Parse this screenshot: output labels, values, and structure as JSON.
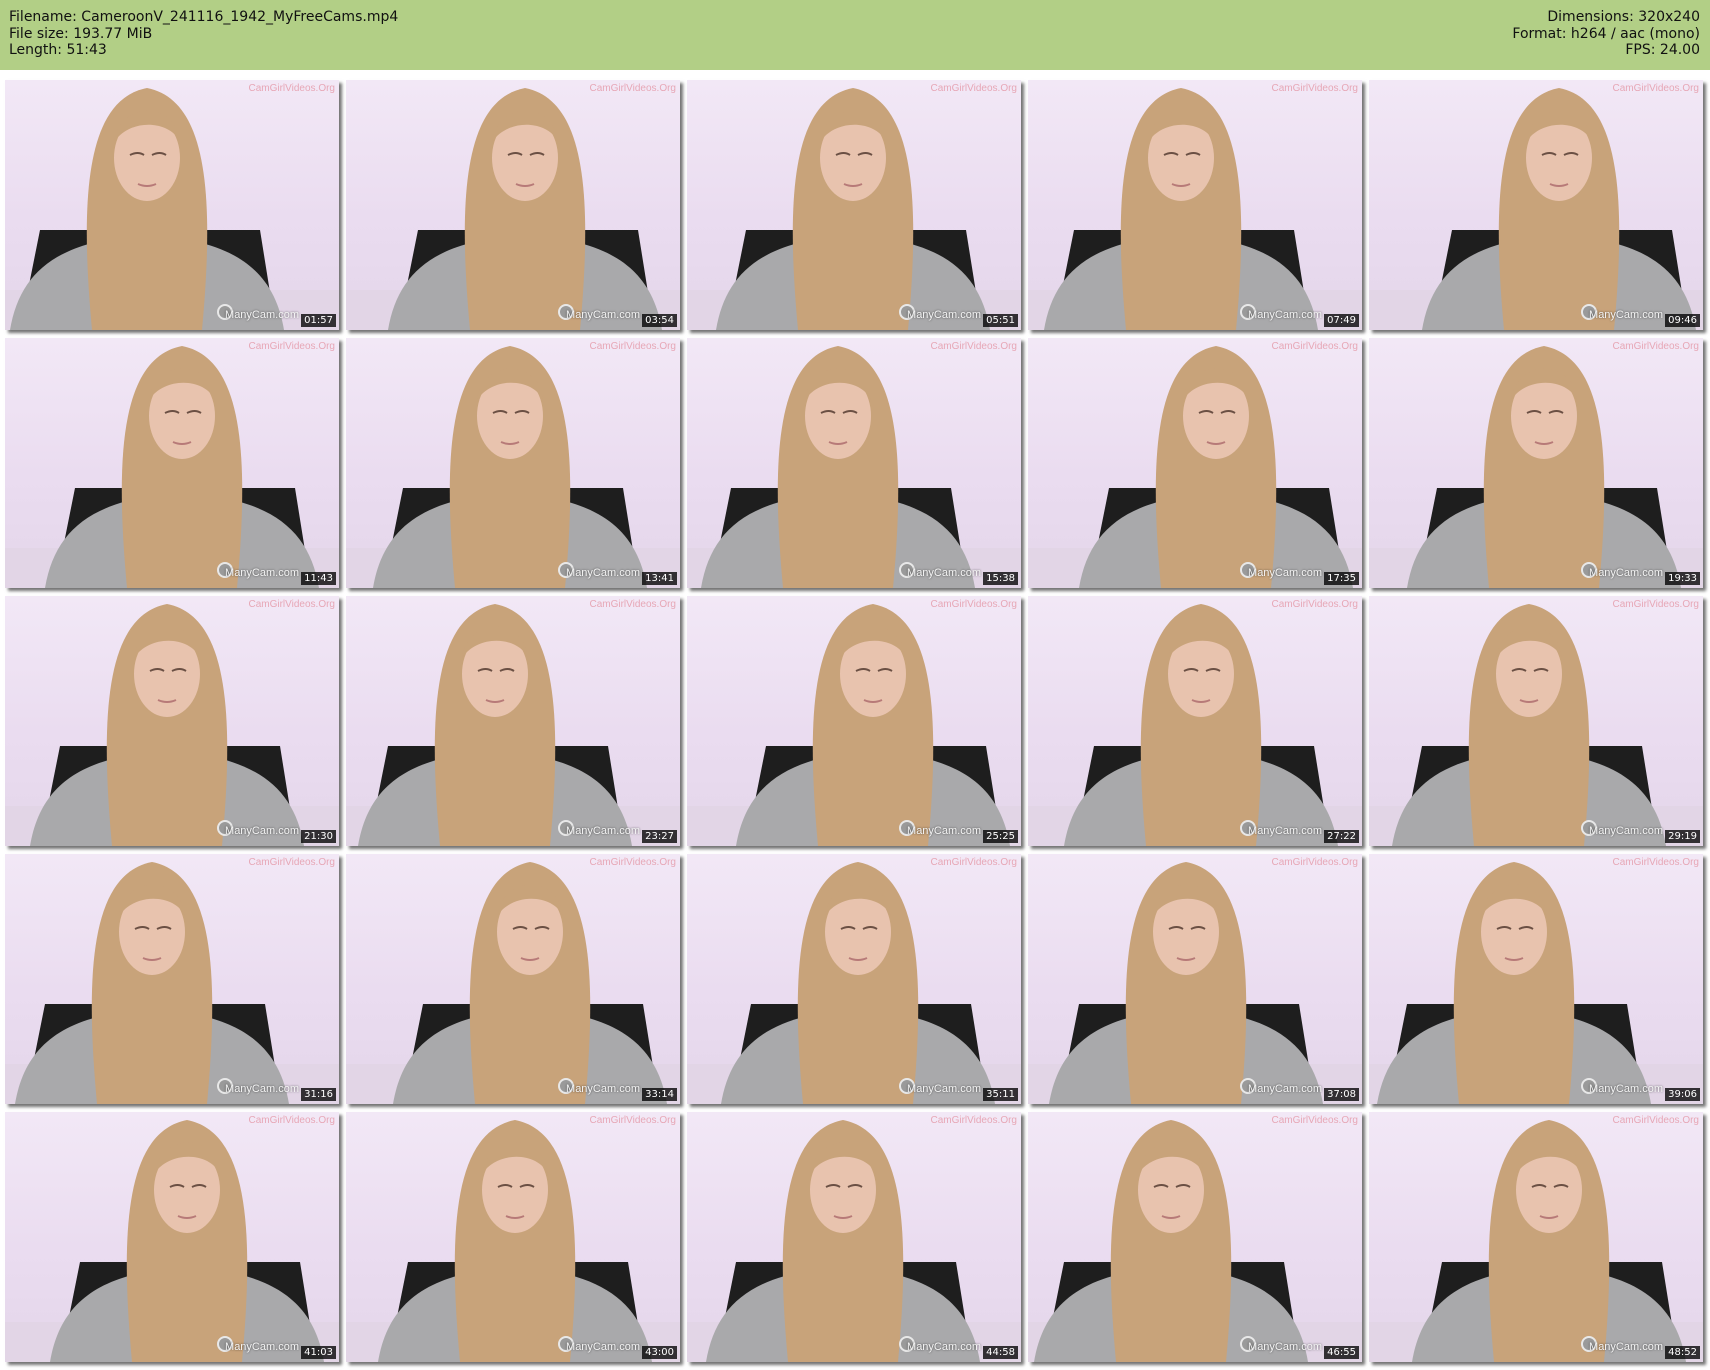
{
  "header": {
    "filename_line": "Filename: CameroonV_241116_1942_MyFreeCams.mp4",
    "filesize_line": "File size: 193.77 MiB",
    "length_line": "Length: 51:43",
    "dimensions_line": "Dimensions: 320x240",
    "format_line": "Format: h264 / aac (mono)",
    "fps_line": "FPS: 24.00"
  },
  "watermarks": {
    "top": "CamGirlVideos.Org",
    "bottom": "ManyCam.com"
  },
  "thumbnails": [
    {
      "time": "01:57"
    },
    {
      "time": "03:54"
    },
    {
      "time": "05:51"
    },
    {
      "time": "07:49"
    },
    {
      "time": "09:46"
    },
    {
      "time": "11:43"
    },
    {
      "time": "13:41"
    },
    {
      "time": "15:38"
    },
    {
      "time": "17:35"
    },
    {
      "time": "19:33"
    },
    {
      "time": "21:30"
    },
    {
      "time": "23:27"
    },
    {
      "time": "25:25"
    },
    {
      "time": "27:22"
    },
    {
      "time": "29:19"
    },
    {
      "time": "31:16"
    },
    {
      "time": "33:14"
    },
    {
      "time": "35:11"
    },
    {
      "time": "37:08"
    },
    {
      "time": "39:06"
    },
    {
      "time": "41:03"
    },
    {
      "time": "43:00"
    },
    {
      "time": "44:58"
    },
    {
      "time": "46:55"
    },
    {
      "time": "48:52"
    }
  ],
  "colors": {
    "header_bg": "#b2cf86",
    "thumb_bg": "#eadcf0",
    "hair": "#c8a37a",
    "sweater": "#a9a9ab",
    "skin": "#e8c3ae"
  }
}
